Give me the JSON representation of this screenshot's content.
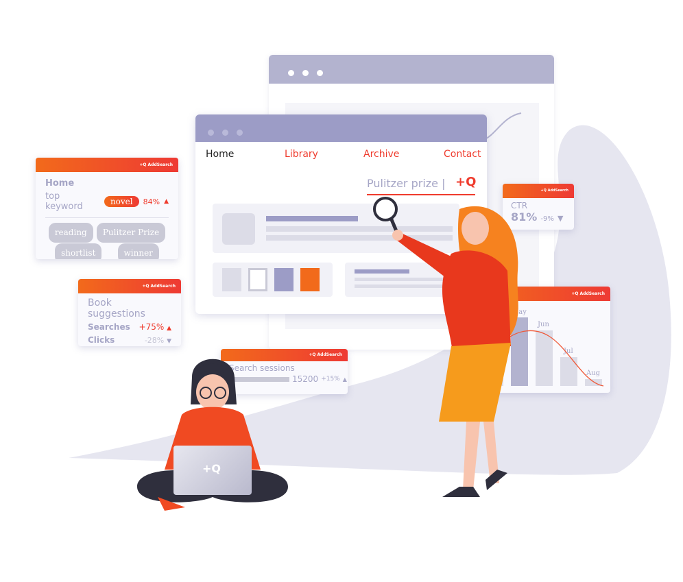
{
  "brand": "+Q AddSearch",
  "colors": {
    "accent": "#ef3b2d",
    "orange": "#f26a1b",
    "lavender": "#9c9cc6",
    "grey_pill": "#c9c9d6"
  },
  "browser": {
    "nav": [
      "Home",
      "Library",
      "Archive",
      "Contact"
    ],
    "search_value": "Pulitzer prize |",
    "search_icon": "+Q"
  },
  "card_keywords": {
    "page": "Home",
    "label": "top keyword",
    "keyword": "novel",
    "change": "84%",
    "tags": [
      "reading",
      "Pulitzer Prize",
      "shortlist",
      "winner"
    ]
  },
  "card_suggestions": {
    "title": "Book suggestions",
    "rows": [
      {
        "label": "Searches",
        "value": "+75%",
        "trend": "up"
      },
      {
        "label": "Clicks",
        "value": "-28%",
        "trend": "down"
      }
    ]
  },
  "card_ctr": {
    "label": "CTR",
    "value": "81%",
    "change": "-9%"
  },
  "card_sessions": {
    "title": "Search sessions",
    "value": "15200",
    "change": "+15%"
  },
  "card_chart": {
    "months": [
      "May",
      "Jun",
      "Jul",
      "Aug"
    ]
  },
  "laptop_logo": "+Q"
}
